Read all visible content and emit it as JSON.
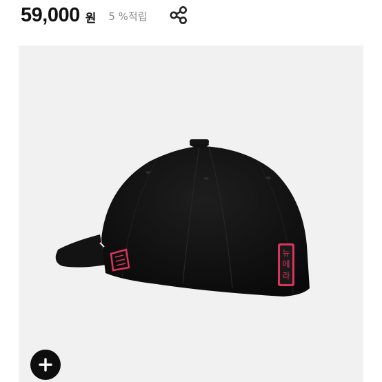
{
  "product": {
    "price": "59,000",
    "currency_label": "원",
    "points_label": "5 %적립"
  },
  "hat_badge": {
    "text": "뉴에라",
    "color": "#d9345a"
  },
  "icons": {
    "share": "share-icon",
    "add": "plus-icon"
  },
  "colors": {
    "image_background": "#f1f1f1",
    "hat": "#0f0f0f",
    "accent": "#d9345a"
  }
}
